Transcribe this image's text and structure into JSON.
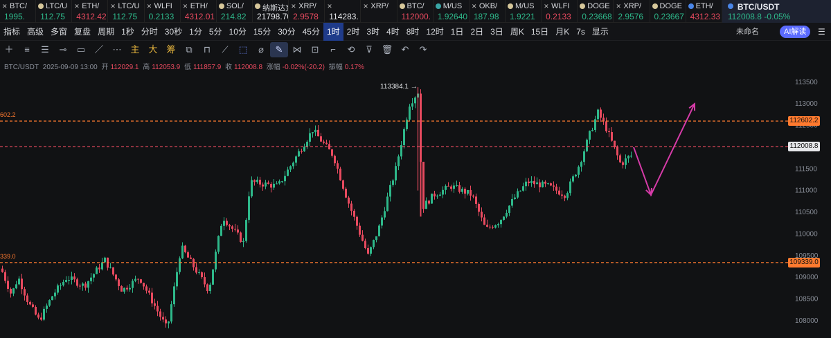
{
  "tickers": [
    {
      "name": "BTC/",
      "price": "1995.",
      "dir": "up",
      "icon": "x-icon"
    },
    {
      "name": "LTC/U",
      "price": "112.75",
      "dir": "up",
      "icon": "coin-icon"
    },
    {
      "name": "ETH/",
      "price": "4312.42",
      "dir": "dn",
      "icon": "x-icon"
    },
    {
      "name": "LTC/U",
      "price": "112.75",
      "dir": "up",
      "icon": "x-icon"
    },
    {
      "name": "WLFI",
      "price": "0.2133",
      "dir": "up",
      "icon": "x-icon"
    },
    {
      "name": "ETH/",
      "price": "4312.01",
      "dir": "dn",
      "icon": "x-icon"
    },
    {
      "name": "SOL/",
      "price": "214.82",
      "dir": "up",
      "icon": "coin-icon"
    },
    {
      "name": "纳斯达克",
      "price": "21798.70",
      "dir": "wh",
      "icon": "coin-icon"
    },
    {
      "name": "XRP/",
      "price": "2.9578",
      "dir": "dn",
      "icon": "x-icon"
    },
    {
      "name": "",
      "price": "114283.",
      "dir": "wh",
      "icon": "x-icon"
    },
    {
      "name": "XRP/",
      "price": "",
      "dir": "wh",
      "icon": "x-icon"
    },
    {
      "name": "BTC/",
      "price": "112000.",
      "dir": "dn",
      "icon": "coin-icon"
    },
    {
      "name": "M/US",
      "price": "1.92640",
      "dir": "up",
      "icon": "teal-icon"
    },
    {
      "name": "OKB/",
      "price": "187.98",
      "dir": "up",
      "icon": "x-icon"
    },
    {
      "name": "M/US",
      "price": "1.9221",
      "dir": "up",
      "icon": "coin-icon"
    },
    {
      "name": "WLFI",
      "price": "0.2133",
      "dir": "dn",
      "icon": "x-icon"
    },
    {
      "name": "DOGE",
      "price": "0.23668",
      "dir": "up",
      "icon": "coin-icon"
    },
    {
      "name": "XRP/",
      "price": "2.9576",
      "dir": "up",
      "icon": "x-icon"
    },
    {
      "name": "DOGE",
      "price": "0.23667",
      "dir": "up",
      "icon": "coin-icon"
    },
    {
      "name": "ETH/",
      "price": "4312.33",
      "dir": "dn",
      "icon": "blue-icon"
    }
  ],
  "active_ticker": {
    "name": "BTC/USDT",
    "price": "112008.8",
    "change": "-0.05%"
  },
  "toolbar": {
    "items": [
      "指标",
      "高级",
      "多窗",
      "复盘",
      "周期",
      "1秒",
      "分时",
      "30秒",
      "1分",
      "5分",
      "10分",
      "15分",
      "30分",
      "45分",
      "1时",
      "2时",
      "3时",
      "4时",
      "8时",
      "12时",
      "1日",
      "2日",
      "3日",
      "周K",
      "15日",
      "月K",
      "7s",
      "显示"
    ],
    "active": "1时",
    "unnamed": "未命名",
    "ai": "AI解读"
  },
  "info": {
    "symbol": "BTC/USDT",
    "datetime": "2025-09-09 13:00",
    "open_label": "开",
    "open": "112029.1",
    "high_label": "高",
    "high": "112053.9",
    "low_label": "低",
    "low": "111857.9",
    "close_label": "收",
    "close": "112008.8",
    "range_label": "涨幅",
    "range": "-0.02%(-20.2)",
    "amp_label": "振幅",
    "amp": "0.17%"
  },
  "chart_data": {
    "type": "candlestick",
    "ylim": [
      107600,
      113800
    ],
    "y_ticks": [
      113500,
      113000,
      112500,
      112000,
      111500,
      111000,
      110500,
      110000,
      109500,
      109000,
      108500,
      108000
    ],
    "hlines": [
      {
        "value": 112602.2,
        "label": "112602.2",
        "color": "#ff7a2f"
      },
      {
        "value": 112008.8,
        "label": "112008.8",
        "color": "#e84a5f"
      },
      {
        "value": 109339.0,
        "label": "109339.0",
        "color": "#ff7a2f"
      }
    ],
    "left_labels": [
      "602.2",
      "339.0"
    ],
    "peak_label": "113384.1 →",
    "projection_path": [
      [
        915,
        112000
      ],
      [
        940,
        110900
      ],
      [
        1003,
        113000
      ]
    ],
    "anchors": [
      [
        0,
        109200
      ],
      [
        15,
        108600
      ],
      [
        25,
        109000
      ],
      [
        40,
        108400
      ],
      [
        55,
        108000
      ],
      [
        75,
        108600
      ],
      [
        95,
        109000
      ],
      [
        120,
        108800
      ],
      [
        150,
        109400
      ],
      [
        175,
        108700
      ],
      [
        200,
        109000
      ],
      [
        240,
        107800
      ],
      [
        260,
        109700
      ],
      [
        300,
        108700
      ],
      [
        320,
        110400
      ],
      [
        350,
        109800
      ],
      [
        360,
        111200
      ],
      [
        400,
        111100
      ],
      [
        450,
        112400
      ],
      [
        480,
        111800
      ],
      [
        500,
        110800
      ],
      [
        530,
        109500
      ],
      [
        545,
        110100
      ],
      [
        570,
        111500
      ],
      [
        590,
        113000
      ],
      [
        603,
        113300
      ],
      [
        608,
        110600
      ],
      [
        625,
        110900
      ],
      [
        650,
        111100
      ],
      [
        680,
        110900
      ],
      [
        700,
        110100
      ],
      [
        720,
        110300
      ],
      [
        740,
        110800
      ],
      [
        760,
        111200
      ],
      [
        790,
        111100
      ],
      [
        815,
        110900
      ],
      [
        835,
        111600
      ],
      [
        850,
        112300
      ],
      [
        862,
        112800
      ],
      [
        875,
        112400
      ],
      [
        895,
        111600
      ],
      [
        908,
        111800
      ]
    ]
  }
}
